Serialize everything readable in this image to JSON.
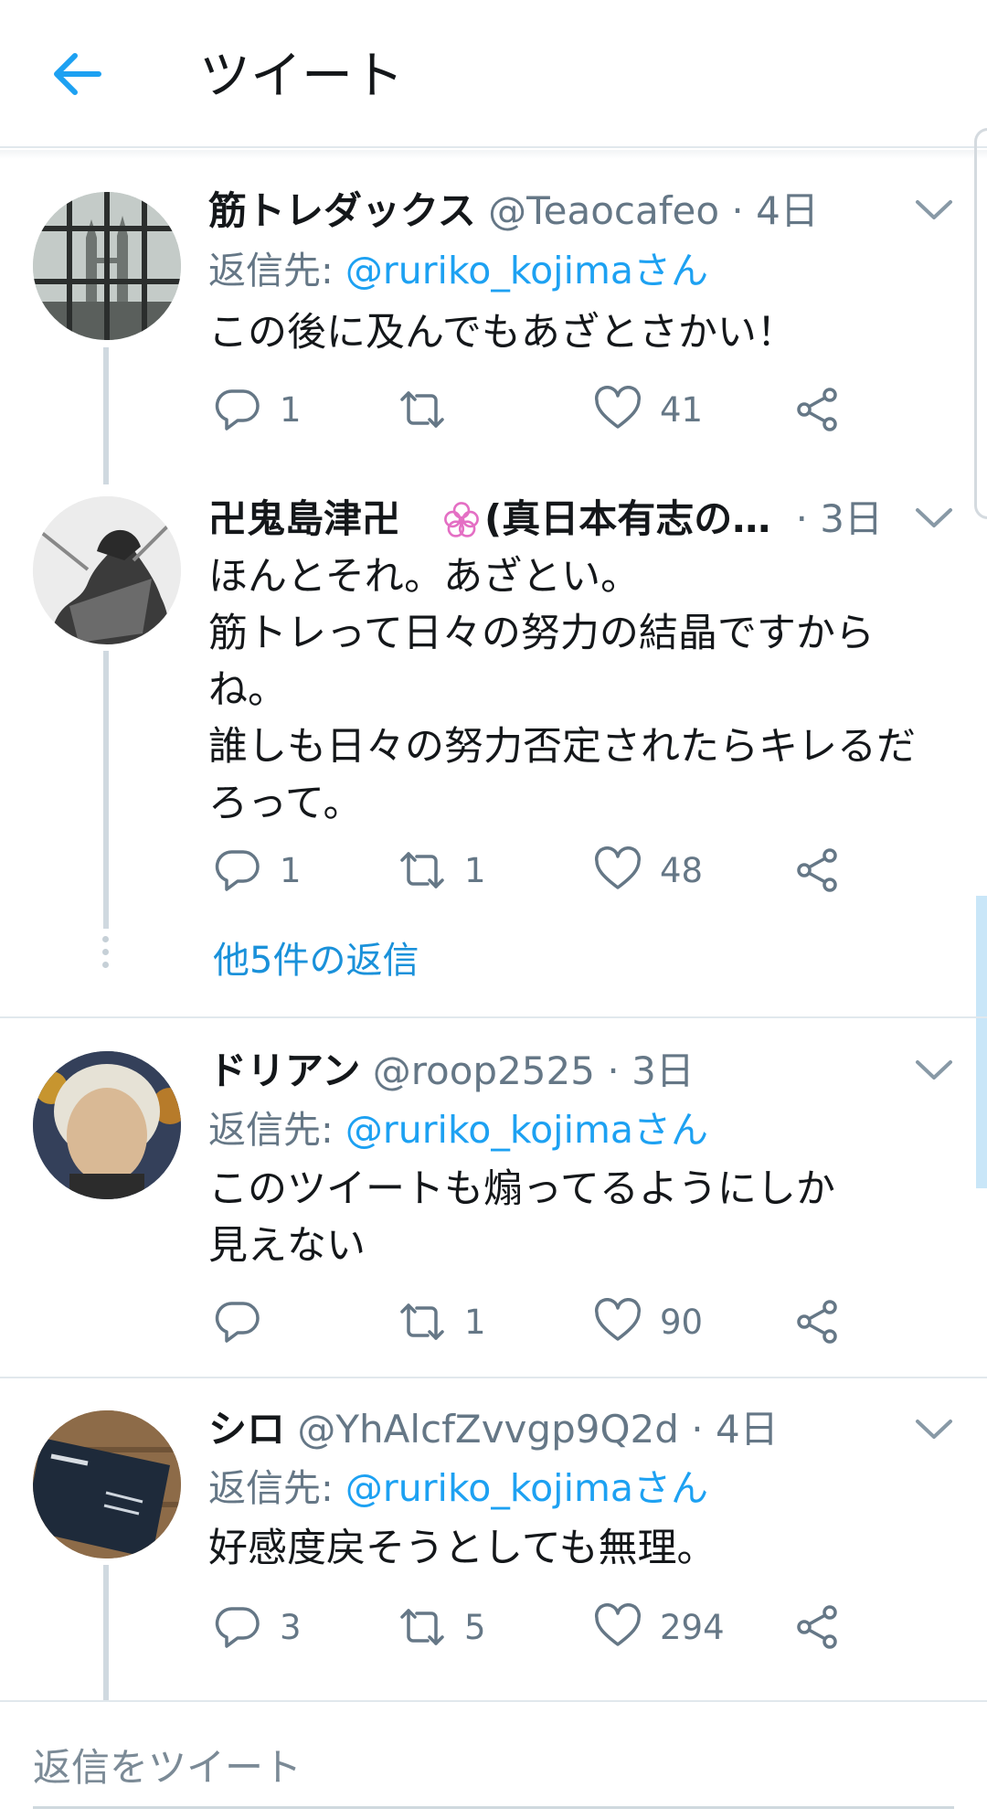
{
  "header": {
    "title": "ツイート"
  },
  "tweets": [
    {
      "name": "筋トレダックス",
      "handle": "@Teaocafeo",
      "separator": "·",
      "time": "4日",
      "reply_label": "返信先: ",
      "reply_to": "@ruriko_kojimaさん",
      "lines": [
        "この後に及んでもあざとさかい！"
      ],
      "replies": "1",
      "retweets": "",
      "likes": "41"
    },
    {
      "name": "卍鬼島津卍　",
      "name_suffix": "(真日本有志の…",
      "separator": "·",
      "time": "3日",
      "lines": [
        "ほんとそれ。あざとい。",
        "筋トレって日々の努力の結晶ですから",
        "ね。",
        "誰しも日々の努力否定されたらキレるだ",
        "ろって。"
      ],
      "replies": "1",
      "retweets": "1",
      "likes": "48"
    },
    {
      "name": "ドリアン",
      "handle": "@roop2525",
      "separator": "·",
      "time": "3日",
      "reply_label": "返信先: ",
      "reply_to": "@ruriko_kojimaさん",
      "lines": [
        "このツイートも煽ってるようにしか",
        "見えない"
      ],
      "replies": "",
      "retweets": "1",
      "likes": "90"
    },
    {
      "name": "シロ",
      "handle": "@YhAlcfZvvgp9Q2d",
      "separator": "·",
      "time": "4日",
      "reply_label": "返信先: ",
      "reply_to": "@ruriko_kojimaさん",
      "lines": [
        "好感度戻そうとしても無理。"
      ],
      "replies": "3",
      "retweets": "5",
      "likes": "294"
    }
  ],
  "more_replies": "他5件の返信",
  "compose": {
    "placeholder": "返信をツイート"
  },
  "colors": {
    "accent": "#1da1f2",
    "text": "#14171a",
    "secondary": "#657786",
    "divider": "#e1e8ed",
    "flower": "#e46fc4"
  },
  "icons": [
    "back-arrow-icon",
    "chevron-down-icon",
    "reply-icon",
    "retweet-icon",
    "like-icon",
    "share-icon",
    "flower-icon"
  ]
}
